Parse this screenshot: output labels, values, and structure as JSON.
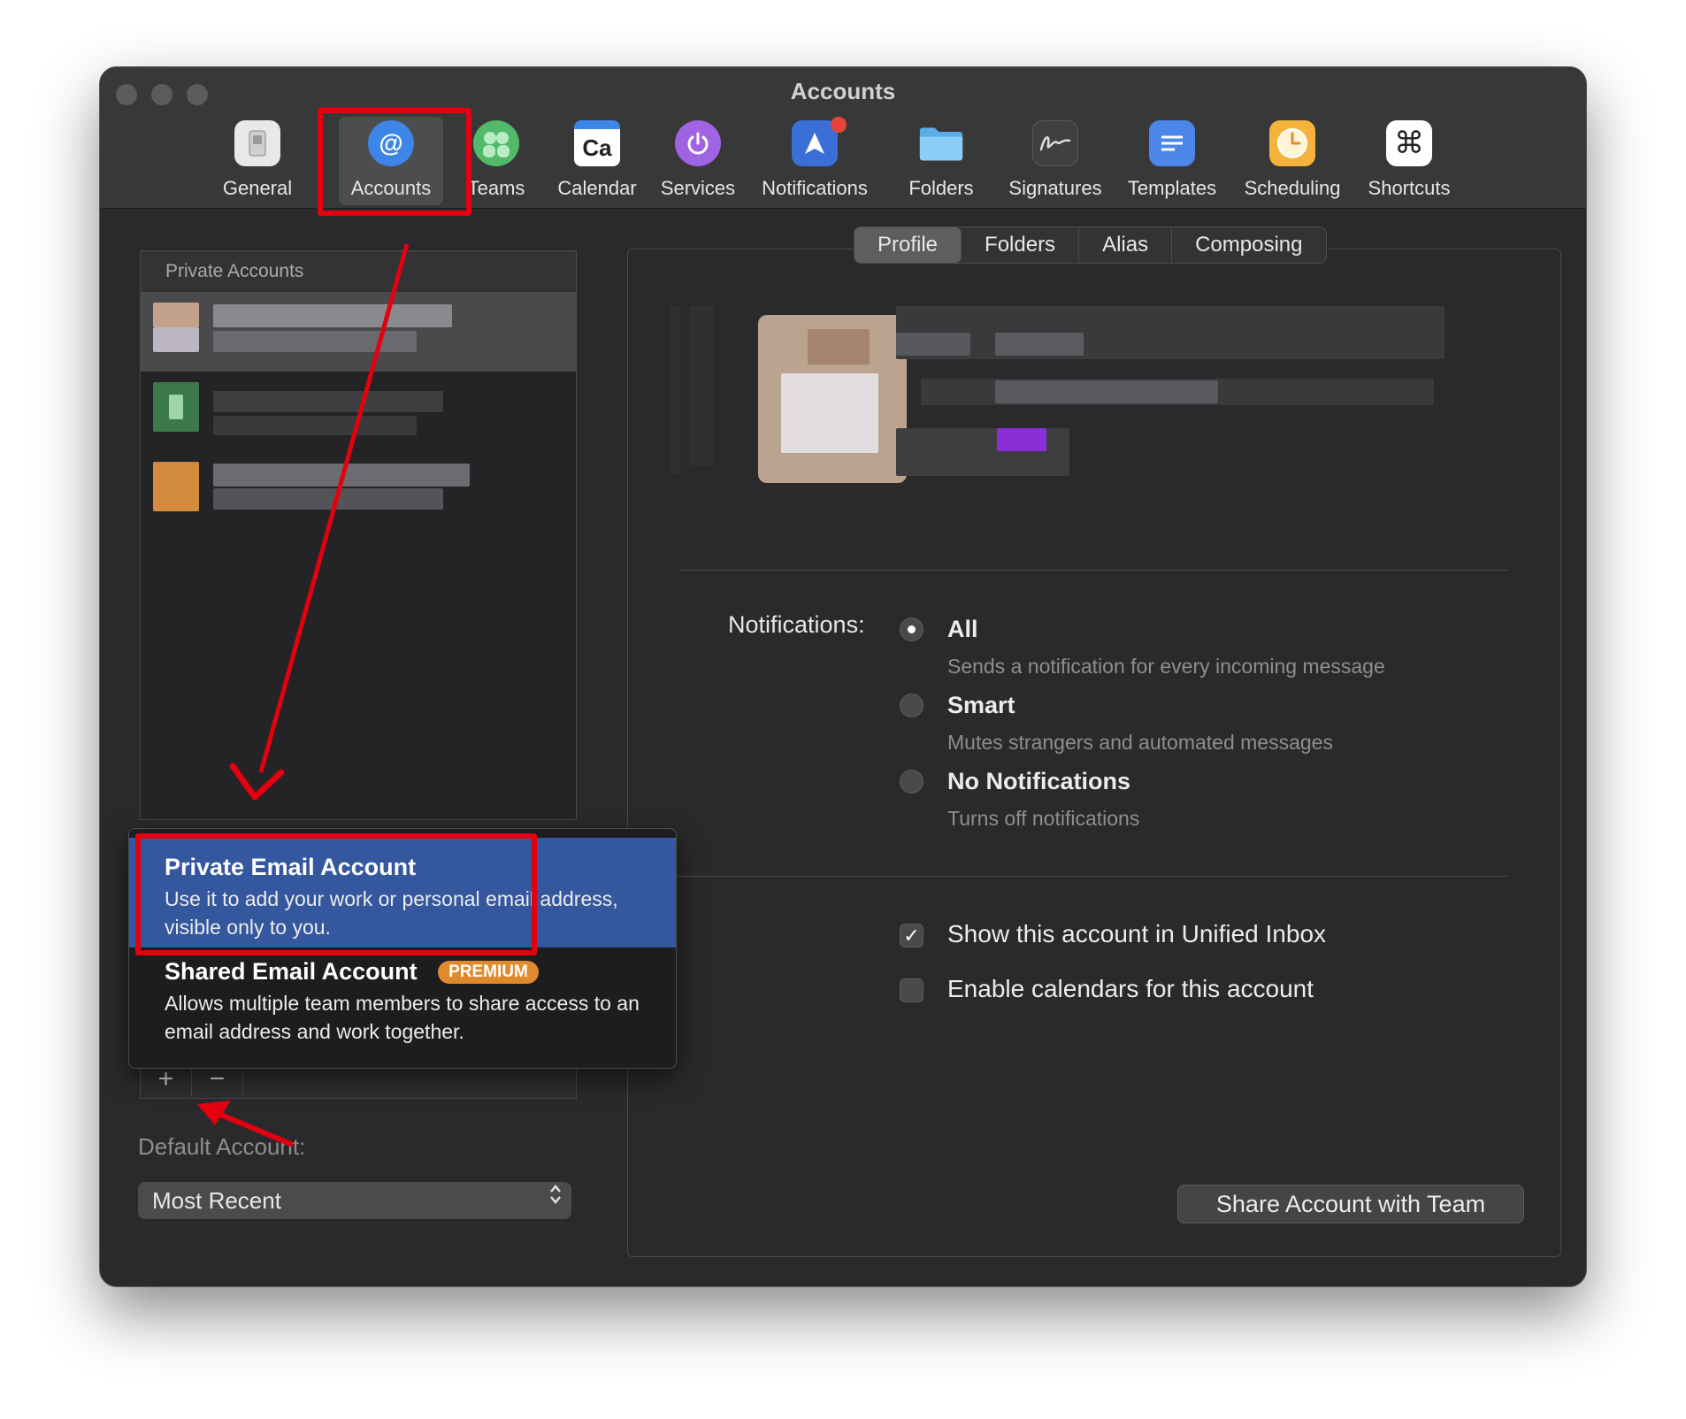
{
  "window": {
    "title": "Accounts"
  },
  "toolbar": {
    "items": [
      {
        "label": "General",
        "icon": "general-switch-icon",
        "color": "#e8e8ea"
      },
      {
        "label": "Accounts",
        "icon": "at-sign-icon",
        "color": "#3d86e8"
      },
      {
        "label": "Teams",
        "icon": "teams-people-icon",
        "color": "#52b96a"
      },
      {
        "label": "Calendar",
        "icon": "calendar-icon",
        "color": "#ffffff"
      },
      {
        "label": "Services",
        "icon": "power-icon",
        "color": "#a063e4"
      },
      {
        "label": "Notifications",
        "icon": "navigation-arrow-icon",
        "color": "#3a6fd8"
      },
      {
        "label": "Folders",
        "icon": "folder-icon",
        "color": "#7cc3f5"
      },
      {
        "label": "Signatures",
        "icon": "signature-icon",
        "color": "#404042"
      },
      {
        "label": "Templates",
        "icon": "template-lines-icon",
        "color": "#4c86e8"
      },
      {
        "label": "Scheduling",
        "icon": "clock-icon",
        "color": "#f4b33c"
      },
      {
        "label": "Shortcuts",
        "icon": "command-key-icon",
        "color": "#ffffff"
      }
    ],
    "calendar_glyph": "Ca",
    "at_glyph": "@",
    "cmd_glyph": "⌘"
  },
  "accounts_list": {
    "header": "Private Accounts"
  },
  "add_menu": {
    "private": {
      "title": "Private Email Account",
      "desc": "Use it to add your work or personal email address, visible only to you."
    },
    "shared": {
      "title": "Shared Email Account",
      "badge": "PREMIUM",
      "desc": "Allows multiple team members to share access to an email address and work together."
    }
  },
  "list_controls": {
    "add": "+",
    "remove": "−"
  },
  "default_account": {
    "label": "Default Account:",
    "value": "Most Recent"
  },
  "tabs": [
    "Profile",
    "Folders",
    "Alias",
    "Composing"
  ],
  "notifications": {
    "label": "Notifications:",
    "options": [
      {
        "title": "All",
        "desc": "Sends a notification for every incoming message",
        "selected": true
      },
      {
        "title": "Smart",
        "desc": "Mutes strangers and automated messages",
        "selected": false
      },
      {
        "title": "No Notifications",
        "desc": "Turns off notifications",
        "selected": false
      }
    ]
  },
  "checks": {
    "unified": {
      "label": "Show this account in Unified Inbox",
      "checked": true
    },
    "calendars": {
      "label": "Enable calendars for this account",
      "checked": false
    }
  },
  "share_button": "Share Account with Team",
  "colors": {
    "accent": "#34579e",
    "highlight": "#e3000f",
    "premium": "#e08a2e"
  }
}
